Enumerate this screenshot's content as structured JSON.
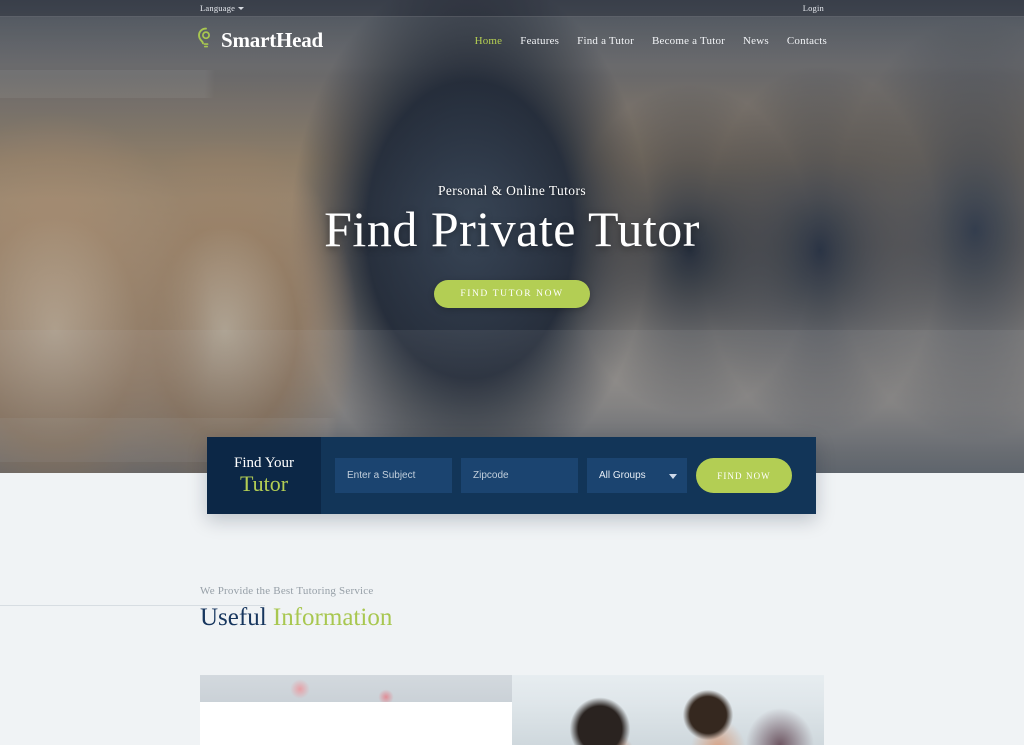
{
  "topbar": {
    "language_label": "Language",
    "language_icon": "chevron-down-icon",
    "login_label": "Login"
  },
  "header": {
    "brand_name": "SmartHead",
    "brand_icon": "lightbulb-logo-icon",
    "nav": [
      {
        "label": "Home",
        "active": true
      },
      {
        "label": "Features",
        "active": false
      },
      {
        "label": "Find a Tutor",
        "active": false
      },
      {
        "label": "Become a Tutor",
        "active": false
      },
      {
        "label": "News",
        "active": false
      },
      {
        "label": "Contacts",
        "active": false
      }
    ]
  },
  "hero": {
    "subtitle": "Personal & Online Tutors",
    "title": "Find Private Tutor",
    "cta_label": "FIND TUTOR NOW"
  },
  "search": {
    "label_line1": "Find Your",
    "label_line2": "Tutor",
    "subject_placeholder": "Enter a Subject",
    "subject_value": "",
    "zipcode_placeholder": "Zipcode",
    "zipcode_value": "",
    "group_selected": "All Groups",
    "group_options": [
      "All Groups"
    ],
    "group_icon": "chevron-down-icon",
    "submit_label": "FIND NOW"
  },
  "info_section": {
    "eyebrow": "We Provide the Best Tutoring Service",
    "title_dark": "Useful",
    "title_green": "Information"
  },
  "colors": {
    "accent_green": "#b3ce54",
    "navy": "#123558",
    "navy_dark": "#0c2746",
    "title_navy": "#17365e",
    "page_background": "#f0f3f5"
  }
}
